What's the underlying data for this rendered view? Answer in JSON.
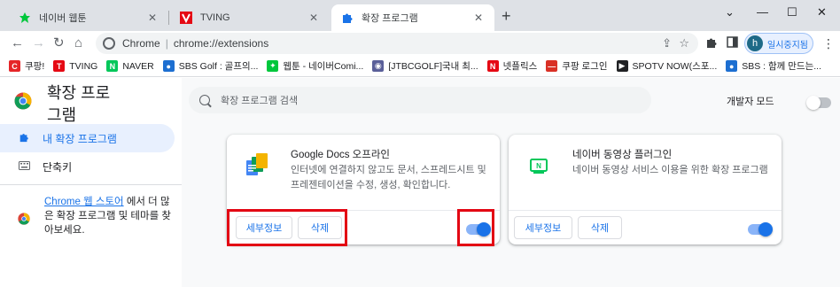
{
  "tabs": [
    {
      "label": "네이버 웹툰",
      "favicon": "naver-webtoon-icon",
      "color": "#00c73c"
    },
    {
      "label": "TVING",
      "favicon": "tving-icon",
      "color": "#e50914"
    },
    {
      "label": "확장 프로그램",
      "favicon": "puzzle-icon",
      "color": "#1a73e8"
    }
  ],
  "toolbar": {
    "omnibox_site": "Chrome",
    "omnibox_url": "chrome://extensions",
    "profile_initial": "h",
    "profile_label": "일시중지됨"
  },
  "bookmarks": [
    {
      "label": "쿠팡!",
      "icon": "coupang-icon",
      "color": "#e52528",
      "glyph": "C"
    },
    {
      "label": "TVING",
      "icon": "tving-icon",
      "color": "#e50914",
      "glyph": "T"
    },
    {
      "label": "NAVER",
      "icon": "naver-icon",
      "color": "#03c75a",
      "glyph": "N"
    },
    {
      "label": "SBS Golf : 골프의...",
      "icon": "sbs-icon",
      "color": "#1d6fd1",
      "glyph": "●"
    },
    {
      "label": "웹툰 - 네이버Comi...",
      "icon": "webtoon-icon",
      "color": "#00c73c",
      "glyph": "✦"
    },
    {
      "label": "[JTBCGOLF]국내 최...",
      "icon": "jtbc-icon",
      "color": "#5a5f99",
      "glyph": "◉"
    },
    {
      "label": "넷플릭스",
      "icon": "netflix-icon",
      "color": "#e50914",
      "glyph": "N"
    },
    {
      "label": "쿠팡 로그인",
      "icon": "coupang-login-icon",
      "color": "#d93025",
      "glyph": "—"
    },
    {
      "label": "SPOTV NOW(스포...",
      "icon": "spotv-icon",
      "color": "#202124",
      "glyph": "▶"
    },
    {
      "label": "SBS : 함께 만드는...",
      "icon": "sbs-icon",
      "color": "#1d6fd1",
      "glyph": "●"
    }
  ],
  "sidebar": {
    "title": "확장 프로그램",
    "items": [
      {
        "label": "내 확장 프로그램",
        "icon": "puzzle-icon",
        "active": true
      },
      {
        "label": "단축키",
        "icon": "keyboard-icon",
        "active": false
      }
    ],
    "store_link": "Chrome 웹 스토어",
    "store_text": "에서 더 많은 확장 프로그램 및 테마를 찾아보세요."
  },
  "search": {
    "placeholder": "확장 프로그램 검색"
  },
  "dev_mode": {
    "label": "개발자 모드",
    "enabled": false
  },
  "extensions": [
    {
      "name": "Google Docs 오프라인",
      "description": "인터넷에 연결하지 않고도 문서, 스프레드시트 및 프레젠테이션을 수정, 생성, 확인합니다.",
      "details_label": "세부정보",
      "remove_label": "삭제",
      "enabled": true,
      "icon": "google-docs-icon"
    },
    {
      "name": "네이버 동영상 플러그인",
      "description": "네이버 동영상 서비스 이용을 위한 확장 프로그램",
      "details_label": "세부정보",
      "remove_label": "삭제",
      "enabled": true,
      "icon": "naver-video-icon"
    }
  ],
  "colors": {
    "accent": "#1a73e8",
    "highlight": "#e30613"
  }
}
